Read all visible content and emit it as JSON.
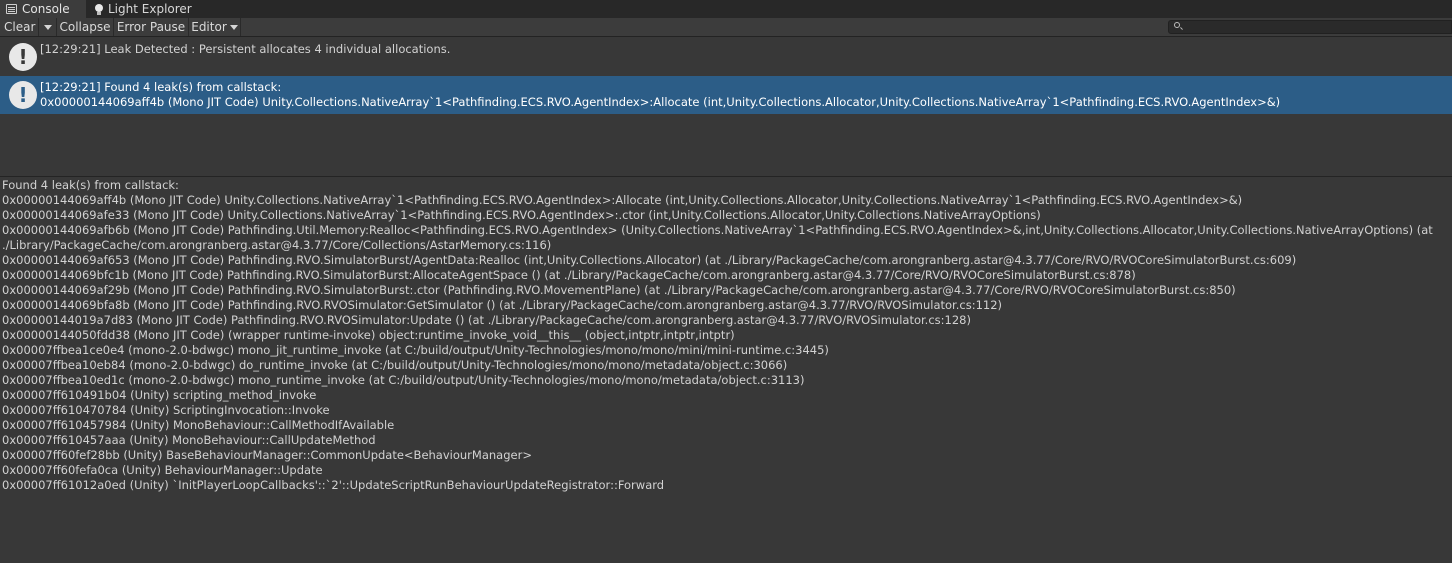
{
  "tabs": [
    {
      "label": "Console",
      "icon": "console-icon",
      "active": true
    },
    {
      "label": "Light Explorer",
      "icon": "light-bulb-icon",
      "active": false
    }
  ],
  "toolbar": {
    "clear_label": "Clear",
    "collapse_label": "Collapse",
    "error_pause_label": "Error Pause",
    "editor_label": "Editor",
    "search_value": "",
    "search_icon": "search-icon"
  },
  "log_entries": [
    {
      "icon": "warning-icon",
      "line1": "[12:29:21] Leak Detected : Persistent allocates 4 individual allocations.",
      "line2": "",
      "selected": false
    },
    {
      "icon": "warning-icon",
      "line1": "[12:29:21] Found 4 leak(s) from callstack:",
      "line2": "0x00000144069aff4b (Mono JIT Code) Unity.Collections.NativeArray`1<Pathfinding.ECS.RVO.AgentIndex>:Allocate (int,Unity.Collections.Allocator,Unity.Collections.NativeArray`1<Pathfinding.ECS.RVO.AgentIndex>&)",
      "selected": true
    }
  ],
  "detail_lines": [
    "Found 4 leak(s) from callstack:",
    "0x00000144069aff4b (Mono JIT Code) Unity.Collections.NativeArray`1<Pathfinding.ECS.RVO.AgentIndex>:Allocate (int,Unity.Collections.Allocator,Unity.Collections.NativeArray`1<Pathfinding.ECS.RVO.AgentIndex>&)",
    "0x00000144069afe33 (Mono JIT Code) Unity.Collections.NativeArray`1<Pathfinding.ECS.RVO.AgentIndex>:.ctor (int,Unity.Collections.Allocator,Unity.Collections.NativeArrayOptions)",
    "0x00000144069afb6b (Mono JIT Code) Pathfinding.Util.Memory:Realloc<Pathfinding.ECS.RVO.AgentIndex> (Unity.Collections.NativeArray`1<Pathfinding.ECS.RVO.AgentIndex>&,int,Unity.Collections.Allocator,Unity.Collections.NativeArrayOptions) (at ./Library/PackageCache/com.arongranberg.astar@4.3.77/Core/Collections/AstarMemory.cs:116)",
    "0x00000144069af653 (Mono JIT Code) Pathfinding.RVO.SimulatorBurst/AgentData:Realloc (int,Unity.Collections.Allocator) (at ./Library/PackageCache/com.arongranberg.astar@4.3.77/Core/RVO/RVOCoreSimulatorBurst.cs:609)",
    "0x00000144069bfc1b (Mono JIT Code) Pathfinding.RVO.SimulatorBurst:AllocateAgentSpace () (at ./Library/PackageCache/com.arongranberg.astar@4.3.77/Core/RVO/RVOCoreSimulatorBurst.cs:878)",
    "0x00000144069af29b (Mono JIT Code) Pathfinding.RVO.SimulatorBurst:.ctor (Pathfinding.RVO.MovementPlane) (at ./Library/PackageCache/com.arongranberg.astar@4.3.77/Core/RVO/RVOCoreSimulatorBurst.cs:850)",
    "0x00000144069bfa8b (Mono JIT Code) Pathfinding.RVO.RVOSimulator:GetSimulator () (at ./Library/PackageCache/com.arongranberg.astar@4.3.77/RVO/RVOSimulator.cs:112)",
    "0x00000144019a7d83 (Mono JIT Code) Pathfinding.RVO.RVOSimulator:Update () (at ./Library/PackageCache/com.arongranberg.astar@4.3.77/RVO/RVOSimulator.cs:128)",
    "0x00000144050fdd38 (Mono JIT Code) (wrapper runtime-invoke) object:runtime_invoke_void__this__ (object,intptr,intptr,intptr)",
    "0x00007ffbea1ce0e4 (mono-2.0-bdwgc) mono_jit_runtime_invoke (at C:/build/output/Unity-Technologies/mono/mono/mini/mini-runtime.c:3445)",
    "0x00007ffbea10eb84 (mono-2.0-bdwgc) do_runtime_invoke (at C:/build/output/Unity-Technologies/mono/mono/metadata/object.c:3066)",
    "0x00007ffbea10ed1c (mono-2.0-bdwgc) mono_runtime_invoke (at C:/build/output/Unity-Technologies/mono/mono/metadata/object.c:3113)",
    "0x00007ff610491b04 (Unity) scripting_method_invoke",
    "0x00007ff610470784 (Unity) ScriptingInvocation::Invoke",
    "0x00007ff610457984 (Unity) MonoBehaviour::CallMethodIfAvailable",
    "0x00007ff610457aaa (Unity) MonoBehaviour::CallUpdateMethod",
    "0x00007ff60fef28bb (Unity) BaseBehaviourManager::CommonUpdate<BehaviourManager>",
    "0x00007ff60fefa0ca (Unity) BehaviourManager::Update",
    "0x00007ff61012a0ed (Unity) `InitPlayerLoopCallbacks'::`2'::UpdateScriptRunBehaviourUpdateRegistrator::Forward"
  ]
}
